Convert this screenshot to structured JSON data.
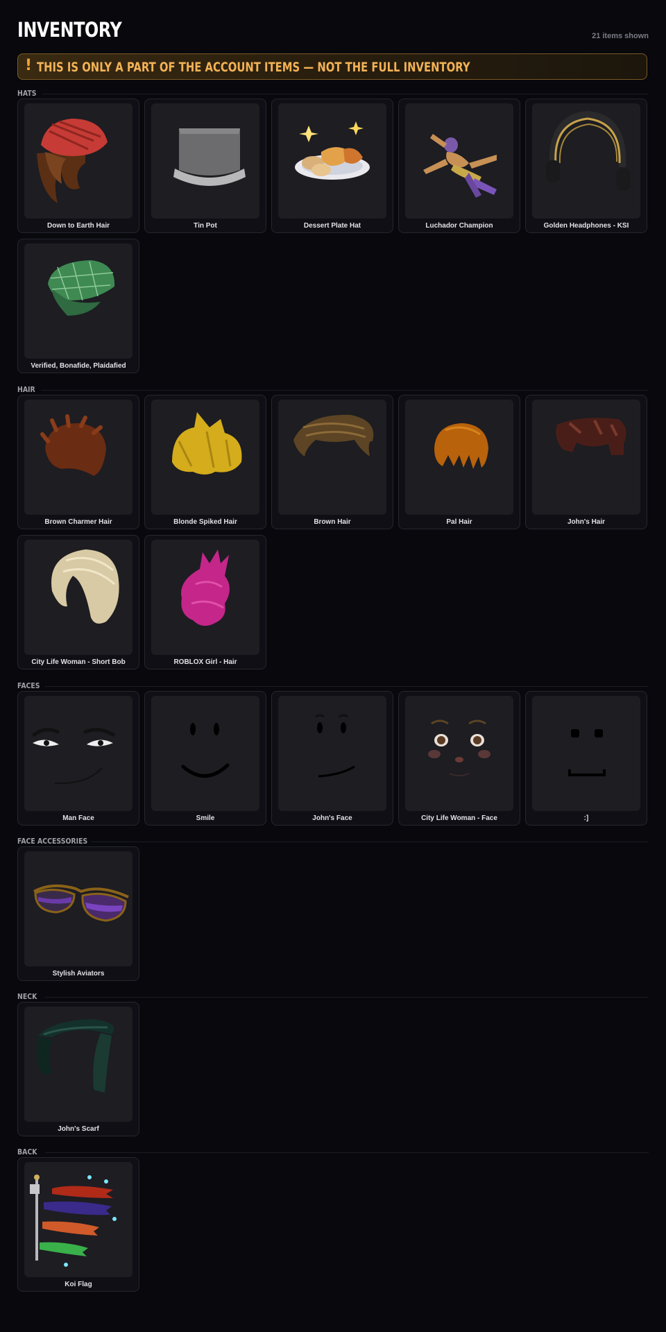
{
  "header": {
    "title": "INVENTORY",
    "count": "21 items shown"
  },
  "banner": {
    "mark": "!",
    "text": "THIS IS ONLY A PART OF THE ACCOUNT ITEMS — NOT THE FULL INVENTORY"
  },
  "sections": [
    {
      "label": "HATS",
      "items": [
        {
          "name": "Down to Earth Hair",
          "icon": "red-beanie-brown-hair-icon"
        },
        {
          "name": "Tin Pot",
          "icon": "tin-pot-icon"
        },
        {
          "name": "Dessert Plate Hat",
          "icon": "dessert-plate-icon"
        },
        {
          "name": "Luchador Champion",
          "icon": "luchador-icon"
        },
        {
          "name": "Golden Headphones - KSI",
          "icon": "headphones-icon"
        },
        {
          "name": "Verified, Bonafide, Plaidafied",
          "icon": "plaid-cap-icon"
        }
      ]
    },
    {
      "label": "HAIR",
      "items": [
        {
          "name": "Brown Charmer Hair",
          "icon": "brown-hair-icon"
        },
        {
          "name": "Blonde Spiked Hair",
          "icon": "blonde-spiked-hair-icon"
        },
        {
          "name": "Brown Hair",
          "icon": "brown-hair-swoop-icon"
        },
        {
          "name": "Pal Hair",
          "icon": "orange-hair-icon"
        },
        {
          "name": "John's Hair",
          "icon": "dark-brown-hair-icon"
        },
        {
          "name": "City Life Woman - Short Bob",
          "icon": "blonde-bob-icon"
        },
        {
          "name": "ROBLOX Girl - Hair",
          "icon": "pink-hair-icon"
        }
      ]
    },
    {
      "label": "FACES",
      "items": [
        {
          "name": "Man Face",
          "icon": "man-face-icon"
        },
        {
          "name": "Smile",
          "icon": "smile-face-icon"
        },
        {
          "name": "John's Face",
          "icon": "johns-face-icon"
        },
        {
          "name": "City Life Woman - Face",
          "icon": "woman-face-icon"
        },
        {
          "name": ":]",
          "icon": "block-face-icon"
        }
      ]
    },
    {
      "label": "FACE ACCESSORIES",
      "items": [
        {
          "name": "Stylish Aviators",
          "icon": "aviators-icon"
        }
      ]
    },
    {
      "label": "NECK",
      "items": [
        {
          "name": "John's Scarf",
          "icon": "scarf-icon"
        }
      ]
    },
    {
      "label": "BACK",
      "items": [
        {
          "name": "Koi Flag",
          "icon": "koi-flag-icon"
        }
      ]
    }
  ]
}
